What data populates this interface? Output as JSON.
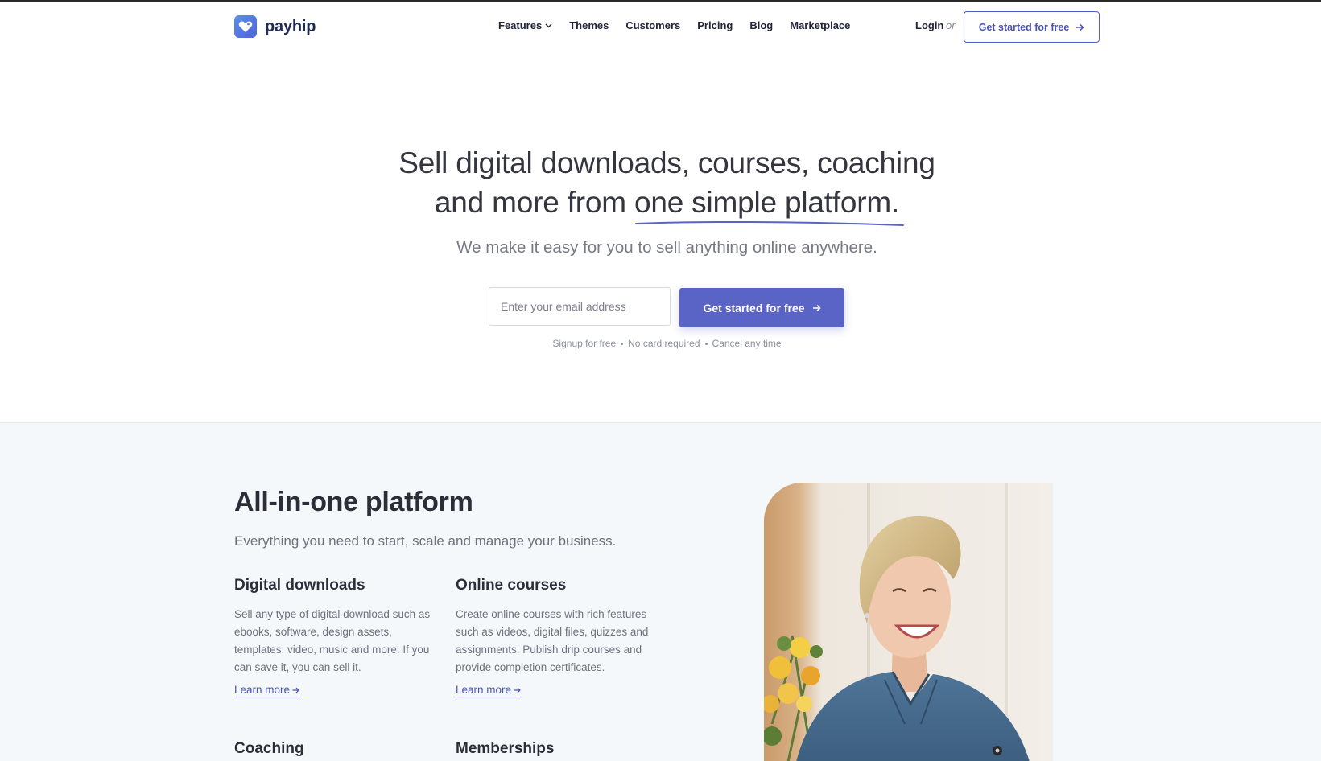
{
  "brand": {
    "name": "payhip",
    "accent": "#5a63c6",
    "logo_icon": "heart-tag-icon"
  },
  "nav": {
    "items": [
      {
        "label": "Features",
        "has_dropdown": true
      },
      {
        "label": "Themes"
      },
      {
        "label": "Customers"
      },
      {
        "label": "Pricing"
      },
      {
        "label": "Blog"
      },
      {
        "label": "Marketplace"
      }
    ],
    "login": "Login",
    "or": "or",
    "cta": "Get started for free"
  },
  "hero": {
    "title_line1": "Sell digital downloads, courses, coaching",
    "title_line2_prefix": "and more from ",
    "title_line2_highlight": "one simple platform",
    "title_line2_suffix": ".",
    "subtitle": "We make it easy for you to sell anything online anywhere.",
    "email_placeholder": "Enter your email address",
    "email_value": "",
    "cta": "Get started for free",
    "fineprint": [
      "Signup for free",
      "No card required",
      "Cancel any time"
    ]
  },
  "section2": {
    "title": "All-in-one platform",
    "subtitle": "Everything you need to start, scale and manage your business.",
    "features": [
      {
        "title": "Digital downloads",
        "description": "Sell any type of digital download such as ebooks, software, design assets, templates, video, music and more. If you can save it, you can sell it.",
        "link": "Learn more"
      },
      {
        "title": "Online courses",
        "description": "Create online courses with rich features such as videos, digital files, quizzes and assignments. Publish drip courses and provide completion certificates.",
        "link": "Learn more"
      },
      {
        "title": "Coaching"
      },
      {
        "title": "Memberships"
      }
    ]
  }
}
